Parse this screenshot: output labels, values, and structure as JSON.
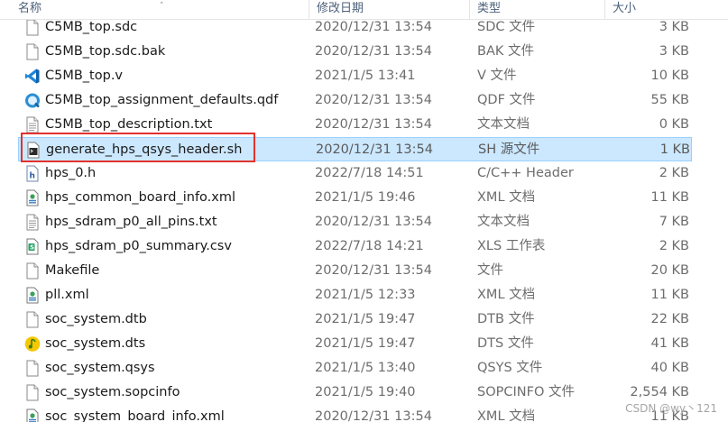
{
  "columns": {
    "name": "名称",
    "modified": "修改日期",
    "type": "类型",
    "size": "大小"
  },
  "files": [
    {
      "name": "C5MB_top.sdc",
      "modified": "2020/12/31 13:54",
      "type": "SDC 文件",
      "size": "3 KB",
      "icon": "generic-file-icon"
    },
    {
      "name": "C5MB_top.sdc.bak",
      "modified": "2020/12/31 13:54",
      "type": "BAK 文件",
      "size": "3 KB",
      "icon": "generic-file-icon"
    },
    {
      "name": "C5MB_top.v",
      "modified": "2021/1/5 13:41",
      "type": "V 文件",
      "size": "10 KB",
      "icon": "vscode-icon"
    },
    {
      "name": "C5MB_top_assignment_defaults.qdf",
      "modified": "2020/12/31 13:54",
      "type": "QDF 文件",
      "size": "55 KB",
      "icon": "quartus-icon"
    },
    {
      "name": "C5MB_top_description.txt",
      "modified": "2020/12/31 13:54",
      "type": "文本文档",
      "size": "0 KB",
      "icon": "text-file-icon"
    },
    {
      "name": "generate_hps_qsys_header.sh",
      "modified": "2020/12/31 13:54",
      "type": "SH 源文件",
      "size": "1 KB",
      "icon": "shell-script-icon"
    },
    {
      "name": "hps_0.h",
      "modified": "2022/7/18 14:51",
      "type": "C/C++ Header",
      "size": "2 KB",
      "icon": "c-header-icon"
    },
    {
      "name": "hps_common_board_info.xml",
      "modified": "2021/1/5 19:46",
      "type": "XML 文档",
      "size": "11 KB",
      "icon": "xml-file-icon"
    },
    {
      "name": "hps_sdram_p0_all_pins.txt",
      "modified": "2020/12/31 13:54",
      "type": "文本文档",
      "size": "7 KB",
      "icon": "text-file-icon"
    },
    {
      "name": "hps_sdram_p0_summary.csv",
      "modified": "2022/7/18 14:21",
      "type": "XLS 工作表",
      "size": "2 KB",
      "icon": "spreadsheet-icon"
    },
    {
      "name": "Makefile",
      "modified": "2020/12/31 13:54",
      "type": "文件",
      "size": "20 KB",
      "icon": "generic-file-icon"
    },
    {
      "name": "pll.xml",
      "modified": "2021/1/5 12:33",
      "type": "XML 文档",
      "size": "11 KB",
      "icon": "xml-file-icon"
    },
    {
      "name": "soc_system.dtb",
      "modified": "2021/1/5 19:47",
      "type": "DTB 文件",
      "size": "22 KB",
      "icon": "generic-file-icon"
    },
    {
      "name": "soc_system.dts",
      "modified": "2021/1/5 19:47",
      "type": "DTS 文件",
      "size": "41 KB",
      "icon": "music-note-icon"
    },
    {
      "name": "soc_system.qsys",
      "modified": "2021/1/5 13:40",
      "type": "QSYS 文件",
      "size": "40 KB",
      "icon": "generic-file-icon"
    },
    {
      "name": "soc_system.sopcinfo",
      "modified": "2021/1/5 19:40",
      "type": "SOPCINFO 文件",
      "size": "2,554 KB",
      "icon": "generic-file-icon"
    },
    {
      "name": "soc_system_board_info.xml",
      "modified": "2020/12/31 13:54",
      "type": "XML 文档",
      "size": "11 KB",
      "icon": "xml-file-icon"
    }
  ],
  "selected_index": 5,
  "watermark": "CSDN @wy丶121",
  "colors": {
    "selection_bg": "#cce8ff",
    "selection_border": "#99d1ff",
    "annotation_red": "#e0322f"
  }
}
